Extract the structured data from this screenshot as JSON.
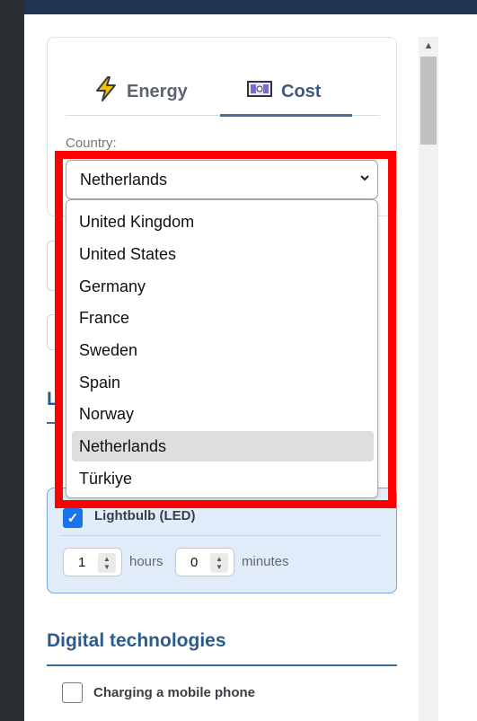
{
  "tabs": {
    "energy_label": "Energy",
    "energy_icon": "lightning-icon",
    "cost_label": "Cost",
    "cost_icon": "banknote-icon",
    "active": "Cost"
  },
  "country": {
    "label": "Country:",
    "selected": "Netherlands",
    "options": [
      "United Kingdom",
      "United States",
      "Germany",
      "France",
      "Sweden",
      "Spain",
      "Norway",
      "Netherlands",
      "Türkiye"
    ]
  },
  "lightbulb": {
    "label": "Lightbulb (LED)",
    "checked": true,
    "hours_value": "1",
    "hours_unit": "hours",
    "minutes_value": "0",
    "minutes_unit": "minutes"
  },
  "digital": {
    "heading": "Digital technologies",
    "item_label": "Charging a mobile phone",
    "item_checked": false
  },
  "partial_heading": "L",
  "colors": {
    "accent": "#1a73e8",
    "heading": "#2c5c8c",
    "highlight": "#ff0000",
    "card_bg": "#e1ecfb"
  }
}
